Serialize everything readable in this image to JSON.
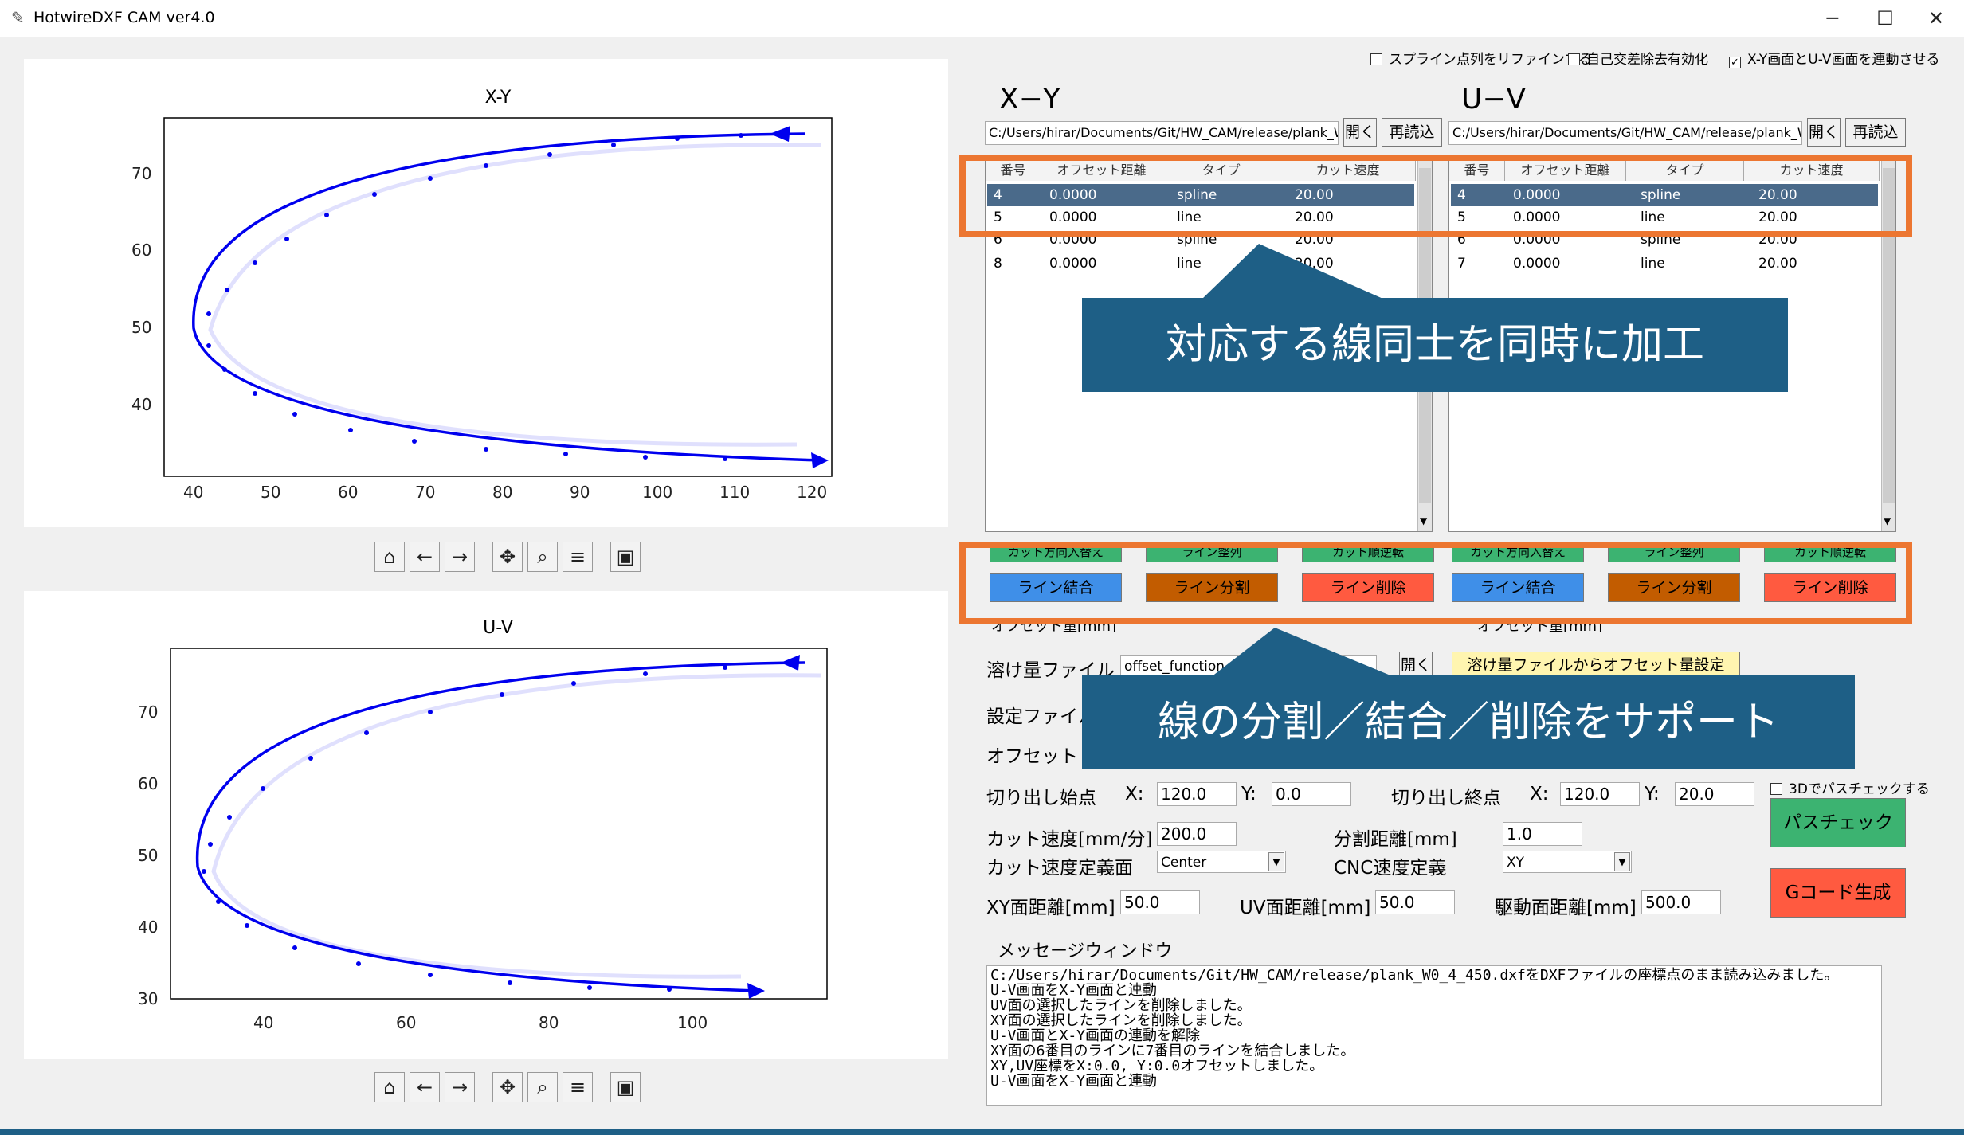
{
  "window": {
    "title": "HotwireDXF CAM ver4.0",
    "minimize": "─",
    "maximize": "☐",
    "close": "✕"
  },
  "options": {
    "refine": "スプライン点列をリファインする",
    "self_intersect": "自己交差除去有効化",
    "link": "X-Y画面とU-V画面を連動させる",
    "link_checked": "✓"
  },
  "plot_xy": {
    "title": "X-Y",
    "xticks": [
      "40",
      "50",
      "60",
      "70",
      "80",
      "90",
      "100",
      "110",
      "120"
    ],
    "yticks": [
      "70",
      "60",
      "50",
      "40"
    ]
  },
  "plot_uv": {
    "title": "U-V",
    "xticks": [
      "40",
      "60",
      "80",
      "100"
    ],
    "yticks": [
      "70",
      "60",
      "50",
      "40",
      "30"
    ]
  },
  "toolbar": {
    "home": "home-icon",
    "back": "back-icon",
    "forward": "forward-icon",
    "pan": "pan-icon",
    "zoom": "zoom-icon",
    "configure": "configure-icon",
    "save": "save-icon"
  },
  "panel_xy": {
    "heading": "X−Y",
    "path": "C:/Users/hirar/Documents/Git/HW_CAM/release/plank_W",
    "open": "開く",
    "reload": "再読込",
    "columns": [
      "番号",
      "オフセット距離",
      "タイプ",
      "カット速度"
    ],
    "rows": [
      [
        "4",
        "0.0000",
        "spline",
        "20.00"
      ],
      [
        "5",
        "0.0000",
        "line",
        "20.00"
      ],
      [
        "6",
        "0.0000",
        "spline",
        "20.00"
      ],
      [
        "8",
        "0.0000",
        "line",
        "20.00"
      ]
    ]
  },
  "panel_uv": {
    "heading": "U−V",
    "path": "C:/Users/hirar/Documents/Git/HW_CAM/release/plank_W",
    "open": "開く",
    "reload": "再読込",
    "columns": [
      "番号",
      "オフセット距離",
      "タイプ",
      "カット速度"
    ],
    "rows": [
      [
        "4",
        "0.0000",
        "spline",
        "20.00"
      ],
      [
        "5",
        "0.0000",
        "line",
        "20.00"
      ],
      [
        "6",
        "0.0000",
        "spline",
        "20.00"
      ],
      [
        "7",
        "0.0000",
        "line",
        "20.00"
      ]
    ]
  },
  "edit_buttons": {
    "reverse": "カット方向入替え",
    "sort": "ライン整列",
    "order": "カット順逆転",
    "merge": "ライン結合",
    "split": "ライン分割",
    "delete": "ライン削除",
    "offset_label": "オフセット量[mm]"
  },
  "callouts": {
    "top": "対応する線同士を同時に加工",
    "bottom": "線の分割／結合／削除をサポート"
  },
  "melt": {
    "label": "溶け量ファイル",
    "value": "offset_function",
    "open": "開く",
    "apply": "溶け量ファイルからオフセット量設定"
  },
  "settings_label": "設定ファイル",
  "offset_label": "オフセット",
  "cut_start": {
    "label": "切り出し始点",
    "x_label": "X:",
    "x": "120.0",
    "y_label": "Y:",
    "y": "0.0"
  },
  "cut_end": {
    "label": "切り出し終点",
    "x_label": "X:",
    "x": "120.0",
    "y_label": "Y:",
    "y": "20.0"
  },
  "path3d": "3Dでパスチェックする",
  "speed": {
    "label": "カット速度[mm/分]",
    "value": "200.0"
  },
  "split_dist": {
    "label": "分割距離[mm]",
    "value": "1.0"
  },
  "speed_plane": {
    "label": "カット速度定義面",
    "value": "Center"
  },
  "cnc_plane": {
    "label": "CNC速度定義",
    "value": "XY"
  },
  "xy_dist": {
    "label": "XY面距離[mm]",
    "value": "50.0"
  },
  "uv_dist": {
    "label": "UV面距離[mm]",
    "value": "50.0"
  },
  "drive_dist": {
    "label": "駆動面距離[mm]",
    "value": "500.0"
  },
  "path_check": "パスチェック",
  "gcode": "Gコード生成",
  "message": {
    "label": "メッセージウィンドウ",
    "lines": "C:/Users/hirar/Documents/Git/HW_CAM/release/plank_W0_4_450.dxfをDXFファイルの座標点のまま読み込みました。\nU-V画面をX-Y画面と連動\nUV面の選択したラインを削除しました。\nXY面の選択したラインを削除しました。\nU-V画面とX-Y画面の連動を解除\nXY面の6番目のラインに7番目のラインを結合しました。\nXY,UV座標をX:0.0, Y:0.0オフセットしました。\nU-V画面をX-Y画面と連動"
  },
  "colors": {
    "curve": "#0000ee",
    "highlight": "#4a6a8a",
    "green": "#3cb371",
    "blue": "#3f8fe8",
    "brown": "#c25c00",
    "red": "#ff5a40",
    "callout": "#1e5f86",
    "orange": "#ec7631"
  }
}
